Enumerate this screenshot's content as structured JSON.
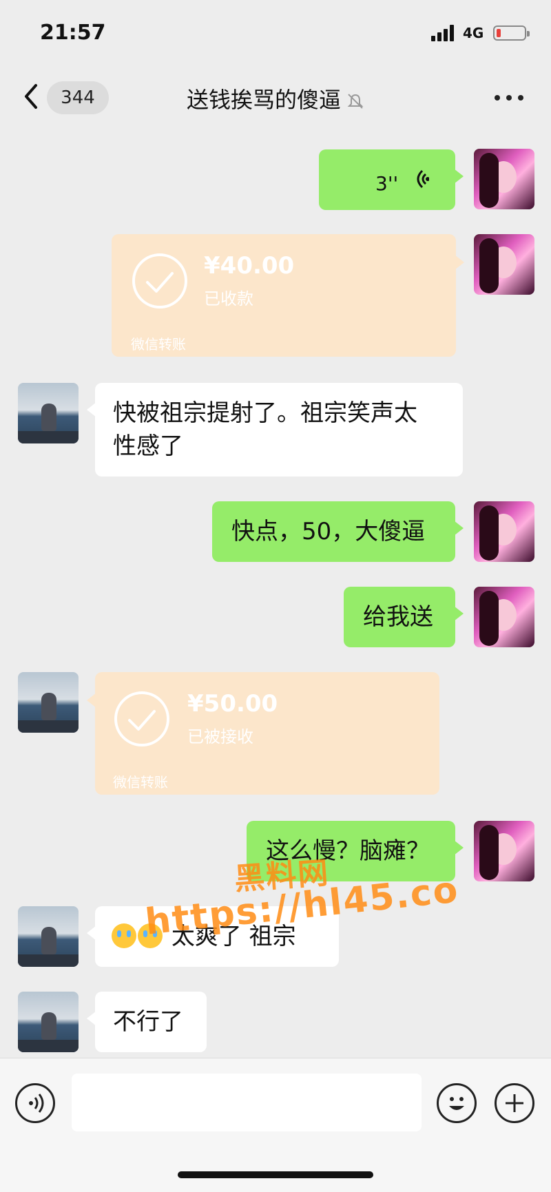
{
  "status_bar": {
    "time": "21:57",
    "network": "4G"
  },
  "nav": {
    "unread_count": "344",
    "title": "送钱挨骂的傻逼"
  },
  "messages": {
    "m0": {
      "duration": "3''"
    },
    "m1": {
      "amount": "¥40.00",
      "status": "已收款",
      "label": "微信转账"
    },
    "m2": {
      "line1": "快被祖宗提射了。祖宗笑声太",
      "line2": "性感了"
    },
    "m3": {
      "text": "快点，50，大傻逼"
    },
    "m4": {
      "text": "给我送"
    },
    "m5": {
      "amount": "¥50.00",
      "status": "已被接收",
      "label": "微信转账"
    },
    "m6": {
      "text": "这么慢？脑瘫？"
    },
    "m7": {
      "text": "太爽了 祖宗"
    },
    "m8": {
      "text": "不行了"
    }
  },
  "watermark": {
    "line1": "黑料网",
    "line2": "https://hl45.co"
  },
  "icons": [
    "back-icon",
    "mute-icon",
    "more-icon",
    "voice-wave-icon",
    "check-circle-icon",
    "crying-emoji-icon",
    "voice-input-icon",
    "emoji-icon",
    "plus-icon"
  ]
}
